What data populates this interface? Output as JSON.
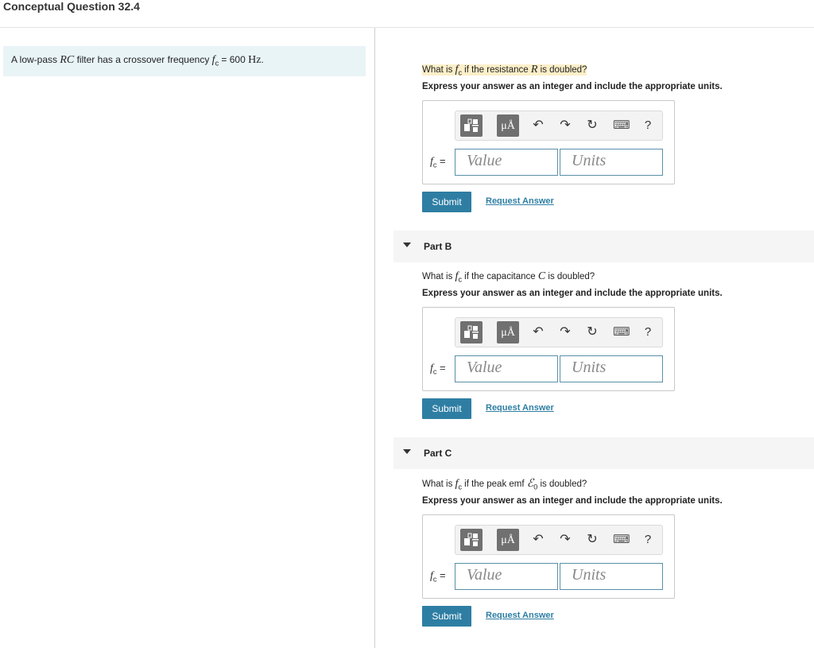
{
  "page": {
    "title": "Conceptual Question 32.4"
  },
  "intro": {
    "pre": "A low-pass ",
    "rc": "RC",
    "mid": " filter has a crossover frequency ",
    "f": "f",
    "sub": "c",
    "eq": " = 600 ",
    "unit": "Hz",
    "end": "."
  },
  "parts": [
    {
      "header": "",
      "q_pre": "What is ",
      "q_f": "f",
      "q_sub": "c",
      "q_mid": " if the resistance ",
      "q_var": "R",
      "q_post": " is doubled?",
      "instruction": "Express your answer as an integer and include the appropriate units.",
      "label_f": "f",
      "label_sub": "c",
      "label_eq": " =",
      "value_placeholder": "Value",
      "units_placeholder": "Units",
      "submit": "Submit",
      "request": "Request Answer"
    },
    {
      "header": "Part B",
      "q_pre": "What is ",
      "q_f": "f",
      "q_sub": "c",
      "q_mid": " if the capacitance ",
      "q_var": "C",
      "q_post": " is doubled?",
      "instruction": "Express your answer as an integer and include the appropriate units.",
      "label_f": "f",
      "label_sub": "c",
      "label_eq": " =",
      "value_placeholder": "Value",
      "units_placeholder": "Units",
      "submit": "Submit",
      "request": "Request Answer"
    },
    {
      "header": "Part C",
      "q_pre": "What is ",
      "q_f": "f",
      "q_sub": "c",
      "q_mid": " if the peak emf ",
      "q_var": "ℰ",
      "q_var_sub": "0",
      "q_post": " is doubled?",
      "instruction": "Express your answer as an integer and include the appropriate units.",
      "label_f": "f",
      "label_sub": "c",
      "label_eq": " =",
      "value_placeholder": "Value",
      "units_placeholder": "Units",
      "submit": "Submit",
      "request": "Request Answer"
    }
  ],
  "toolbar": {
    "units_btn": "μÅ",
    "undo": "↶",
    "redo": "↷",
    "reset": "↻",
    "keyboard": "⌨",
    "help": "?"
  }
}
